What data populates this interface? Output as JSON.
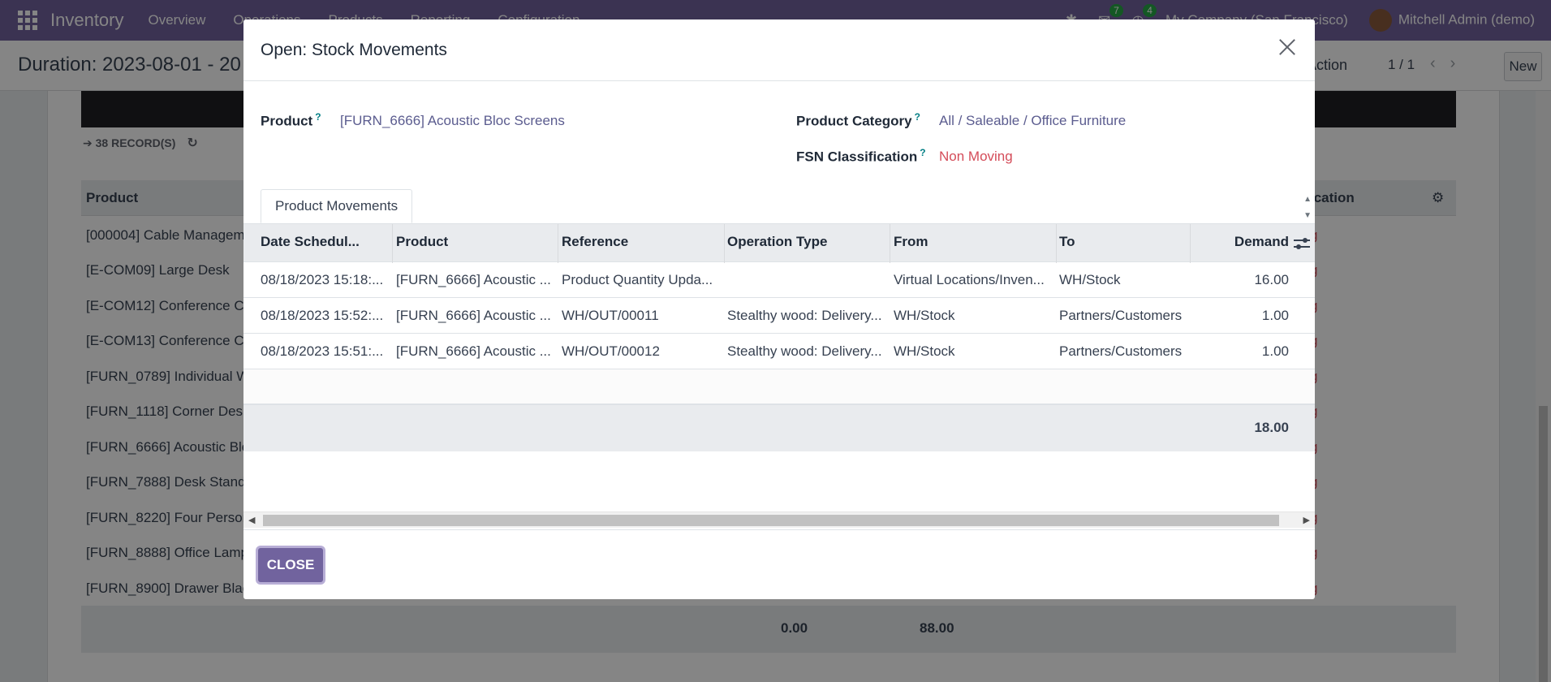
{
  "navbar": {
    "app_name": "Inventory",
    "menu": [
      "Overview",
      "Operations",
      "Products",
      "Reporting",
      "Configuration"
    ],
    "messages_count": "7",
    "activities_count": "4",
    "company": "My Company (San Francisco)",
    "user": "Mitchell Admin (demo)"
  },
  "control_panel": {
    "title": "Duration: 2023-08-01 - 20",
    "action_label": "Action",
    "pager": "1 / 1",
    "new_label": "New"
  },
  "background_list": {
    "records_label": "38 RECORD(S)",
    "col_product": "Product",
    "col_classification": "ication",
    "rows": [
      "[000004] Cable Managem",
      "[E-COM09] Large Desk",
      "[E-COM12] Conference C",
      "[E-COM13] Conference C",
      "[FURN_0789] Individual W",
      "[FURN_1118] Corner Desk",
      "[FURN_6666] Acoustic Blo",
      "[FURN_7888] Desk Stand",
      "[FURN_8220] Four Person",
      "[FURN_8888] Office Lamp",
      "[FURN_8900] Drawer Blac"
    ],
    "row_tags": [
      "g",
      "g",
      "g",
      "g",
      "g",
      "g",
      "g",
      "g",
      "g",
      "g",
      "g"
    ],
    "total_1": "0.00",
    "total_2": "88.00"
  },
  "modal": {
    "title": "Open: Stock Movements",
    "product_label": "Product",
    "product_value": "[FURN_6666] Acoustic Bloc Screens",
    "category_label": "Product Category",
    "category_value": "All / Saleable / Office Furniture",
    "fsn_label": "FSN Classification",
    "fsn_value": "Non Moving",
    "help_mark": "?",
    "tab_label": "Product Movements",
    "columns": {
      "date": "Date Schedul...",
      "product": "Product",
      "reference": "Reference",
      "operation_type": "Operation Type",
      "from": "From",
      "to": "To",
      "demand": "Demand"
    },
    "rows": [
      {
        "date": "08/18/2023 15:18:...",
        "product": "[FURN_6666] Acoustic ...",
        "reference": "Product Quantity Upda...",
        "operation_type": "",
        "from": "Virtual Locations/Inven...",
        "to": "WH/Stock",
        "demand": "16.00"
      },
      {
        "date": "08/18/2023 15:52:...",
        "product": "[FURN_6666] Acoustic ...",
        "reference": "WH/OUT/00011",
        "operation_type": "Stealthy wood: Delivery...",
        "from": "WH/Stock",
        "to": "Partners/Customers",
        "demand": "1.00"
      },
      {
        "date": "08/18/2023 15:51:...",
        "product": "[FURN_6666] Acoustic ...",
        "reference": "WH/OUT/00012",
        "operation_type": "Stealthy wood: Delivery...",
        "from": "WH/Stock",
        "to": "Partners/Customers",
        "demand": "1.00"
      }
    ],
    "total_demand": "18.00",
    "close_label": "CLOSE"
  },
  "colors": {
    "brand": "#71639e",
    "link": "#5b5c8f",
    "danger": "#d44c59",
    "help": "#017e84"
  }
}
